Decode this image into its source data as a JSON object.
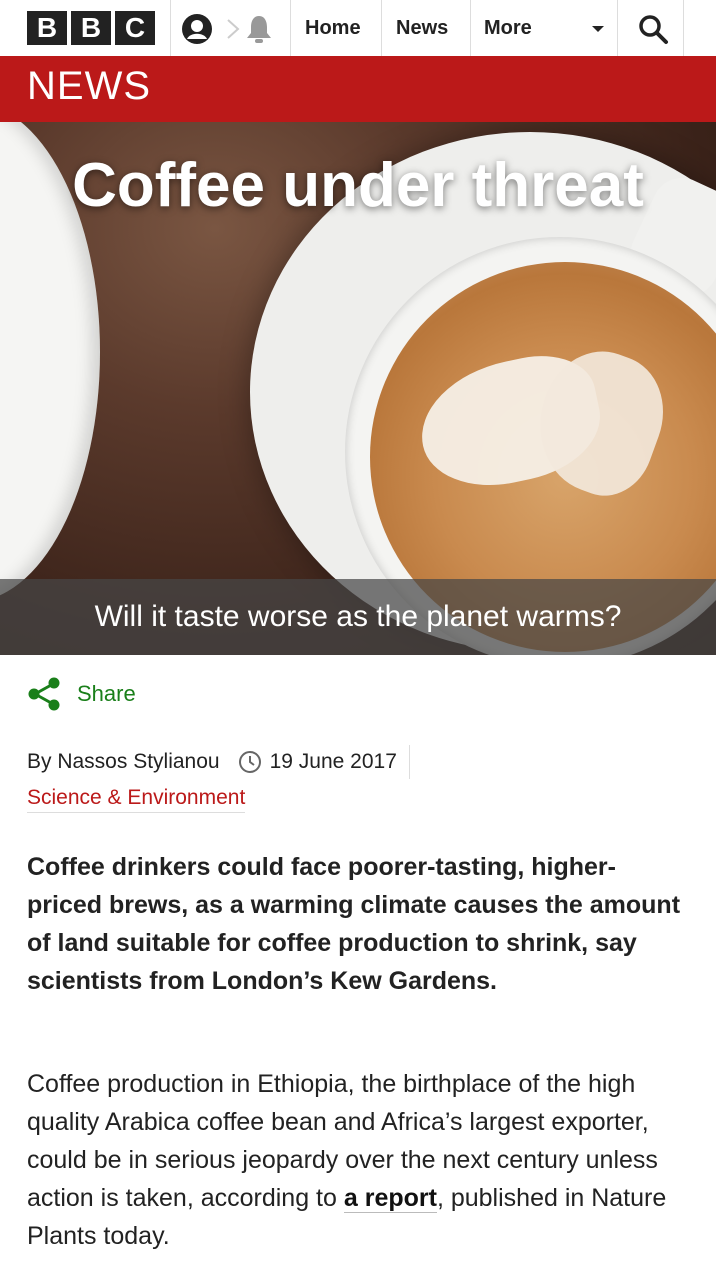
{
  "header": {
    "logo_letters": [
      "B",
      "B",
      "C"
    ],
    "nav": {
      "home": "Home",
      "news": "News",
      "more": "More"
    }
  },
  "newsbar": {
    "label": "NEWS"
  },
  "hero": {
    "title": "Coffee under threat",
    "subtitle": "Will it taste worse as the planet warms?"
  },
  "share": {
    "label": "Share"
  },
  "byline": {
    "author": "By Nassos Stylianou",
    "date": "19 June 2017",
    "section": "Science & Environment"
  },
  "article": {
    "intro": "Coffee drinkers could face poorer-tasting, higher-priced brews, as a warming climate causes the amount of land suitable for coffee production to shrink, say scientists from London’s Kew Gardens.",
    "para1_before": "Coffee production in Ethiopia, the birthplace of the high quality Arabica coffee bean and Africa’s largest exporter, could be in serious jeopardy over the next century unless action is taken, according to ",
    "para1_link": "a report",
    "para1_after": ", published in Nature Plants today."
  },
  "colors": {
    "brand_red": "#bb1919",
    "share_green": "#1a7f1a"
  }
}
